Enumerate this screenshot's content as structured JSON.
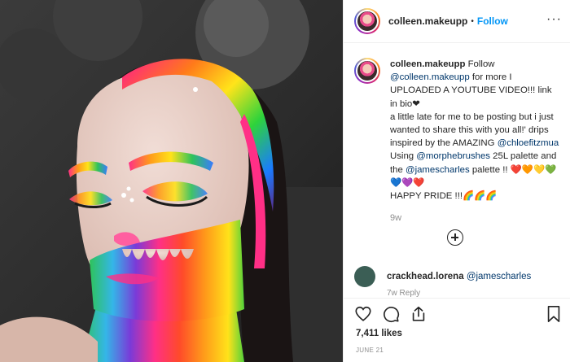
{
  "post": {
    "username": "colleen.makeupp",
    "dot": "•",
    "follow_label": "Follow",
    "more_label": "···"
  },
  "caption": {
    "username": "colleen.makeupp",
    "follow": "Follow",
    "mention_self": "@colleen.makeupp",
    "line1_rest": " for more I UPLOADED A YOUTUBE VIDEO!!! link in bio",
    "line1_heart": "❤",
    "line2": "a little late for me to be posting but i just wanted to share this with you all!' drips inspired by the AMAZING ",
    "mention_chloe": "@chloefitzmua",
    "using": " Using ",
    "mention_morphe": "@morphebrushes",
    "palette_text": " 25L palette and the ",
    "mention_james": "@jamescharles",
    "palette_end": " palette !! ",
    "emoji_hearts": "❤️🧡💛💚💙💜❤️",
    "happy": "HAPPY PRIDE !!!",
    "emoji_rainbows": "🌈🌈🌈",
    "time": "9w"
  },
  "comment": {
    "username": "crackhead.lorena",
    "mention": "@jamescharles",
    "meta": "7w    Reply"
  },
  "stats": {
    "likes": "7,411 likes",
    "date": "JUNE 21"
  },
  "icons": [
    "heart-icon",
    "comment-icon",
    "share-icon",
    "bookmark-icon",
    "more-options-icon",
    "add-comment-icon"
  ],
  "colors": {
    "accent": "#0095f6",
    "link": "#00376b",
    "muted": "#8e8e8e",
    "border": "#efefef"
  }
}
